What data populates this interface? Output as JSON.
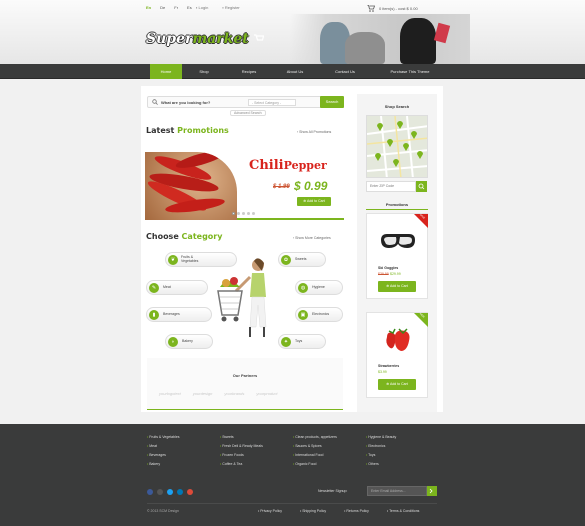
{
  "header": {
    "languages": [
      "En",
      "De",
      "Fr",
      "Es"
    ],
    "login": "Login",
    "register": "Register",
    "cart_text": "0 item(s) - cost $ 0.00",
    "logo_main": "Super",
    "logo_accent": "market"
  },
  "nav": {
    "items": [
      "Home",
      "Shop",
      "Recipes",
      "About Us",
      "Contact Us",
      "Purchase This Theme"
    ]
  },
  "search": {
    "prompt": "What are you looking for?",
    "category_placeholder": "- Select Category -",
    "button": "Search",
    "advanced": "Advanced Search"
  },
  "promotions": {
    "title_plain": "Latest",
    "title_accent": "Promotions",
    "view_all": "Show All Promotions",
    "product_line1": "Chili",
    "product_line2": "Pepper",
    "old_price": "$ 1.99",
    "new_price": "$ 0.99",
    "add_to_cart": "Add to Cart"
  },
  "categories": {
    "title_plain": "Choose",
    "title_accent": "Category",
    "show_more": "Show More Categories",
    "left": [
      "Fruits &\nVegetables",
      "Meat",
      "Beverages",
      "Bakery"
    ],
    "right": [
      "Sweets",
      "Hygiene",
      "Electronics",
      "Toys"
    ]
  },
  "partners": {
    "title": "Our Partners",
    "names": [
      "yourlogotext",
      "yourdesign",
      "yourbrands",
      "yourproduct"
    ]
  },
  "sidebar": {
    "shop_search_title": "Shop Search",
    "zip_placeholder": "Enter ZIP Code",
    "promotions_title": "Promotions",
    "products": [
      {
        "name": "Ski Goggles",
        "old_price": "$39.99",
        "new_price": "$29.99",
        "button": "Add to Cart",
        "ribbon": "SALE"
      },
      {
        "name": "Strawberries",
        "old_price": "",
        "new_price": "$3.99",
        "button": "Add to Cart",
        "ribbon": "NEW"
      }
    ]
  },
  "footer": {
    "col1": [
      "Fruits & Vegetables",
      "Meat",
      "Beverages",
      "Bakery"
    ],
    "col2": [
      "Sweets",
      "Fresh Deli & Ready Meals",
      "Frozen Foods",
      "Coffee & Tea"
    ],
    "col3": [
      "Clean products, appetizers",
      "Sauces & Spices",
      "International Food",
      "Organic Food"
    ],
    "col4": [
      "Hygiene & Beauty",
      "Electronics",
      "Toys",
      "Others"
    ],
    "newsletter_label": "Newsletter Signup:",
    "newsletter_placeholder": "Enter Email Address...",
    "copyright": "© 2013 SCM Design",
    "links": [
      "Privacy Policy",
      "Shipping Policy",
      "Returns Policy",
      "Terms & Conditions"
    ]
  },
  "colors": {
    "accent": "#7cb51e",
    "nav_bg": "#3a3b3b",
    "promo_red": "#d8231c"
  }
}
